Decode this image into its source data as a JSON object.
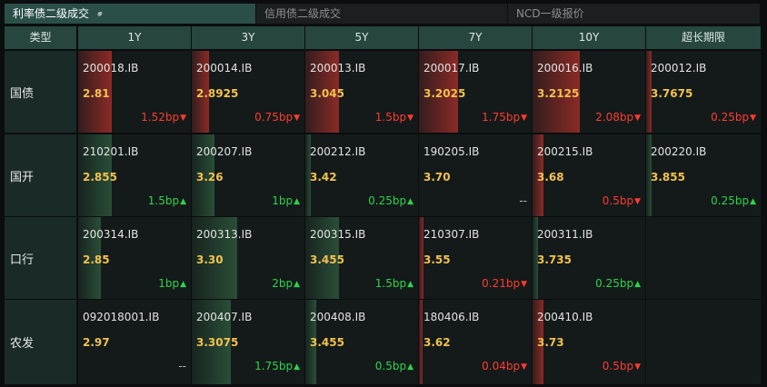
{
  "tabs": [
    {
      "label": "利率债二级成交",
      "active": true
    },
    {
      "label": "信用债二级成交",
      "active": false
    },
    {
      "label": "NCD一级报价",
      "active": false
    }
  ],
  "header": {
    "type_label": "类型",
    "tenors": [
      "1Y",
      "3Y",
      "5Y",
      "7Y",
      "10Y",
      "超长期限"
    ]
  },
  "colors": {
    "up": "#ff3b30",
    "down": "#2ed34a",
    "yield": "#f2c14e",
    "header_bg": "#26463f",
    "active_tab": "#2a4f49"
  },
  "rows": [
    {
      "type": "国债",
      "cells": [
        {
          "code": "200018.IB",
          "yield": "2.81",
          "change": "1.52bp",
          "dir": "up",
          "bar": 0.3
        },
        {
          "code": "200014.IB",
          "yield": "2.8925",
          "change": "0.75bp",
          "dir": "up",
          "bar": 0.15
        },
        {
          "code": "200013.IB",
          "yield": "3.045",
          "change": "1.5bp",
          "dir": "up",
          "bar": 0.3
        },
        {
          "code": "200017.IB",
          "yield": "3.2025",
          "change": "1.75bp",
          "dir": "up",
          "bar": 0.35
        },
        {
          "code": "200016.IB",
          "yield": "3.2125",
          "change": "2.08bp",
          "dir": "up",
          "bar": 0.42
        },
        {
          "code": "200012.IB",
          "yield": "3.7675",
          "change": "0.25bp",
          "dir": "up",
          "bar": 0.05
        }
      ]
    },
    {
      "type": "国开",
      "cells": [
        {
          "code": "210201.IB",
          "yield": "2.855",
          "change": "1.5bp",
          "dir": "down",
          "bar": 0.3
        },
        {
          "code": "200207.IB",
          "yield": "3.26",
          "change": "1bp",
          "dir": "down",
          "bar": 0.2
        },
        {
          "code": "200212.IB",
          "yield": "3.42",
          "change": "0.25bp",
          "dir": "down",
          "bar": 0.05
        },
        {
          "code": "190205.IB",
          "yield": "3.70",
          "change": "--",
          "dir": "flat",
          "bar": 0
        },
        {
          "code": "200215.IB",
          "yield": "3.68",
          "change": "0.5bp",
          "dir": "up",
          "bar": 0.1
        },
        {
          "code": "200220.IB",
          "yield": "3.855",
          "change": "0.25bp",
          "dir": "down",
          "bar": 0.05
        }
      ]
    },
    {
      "type": "口行",
      "cells": [
        {
          "code": "200314.IB",
          "yield": "2.85",
          "change": "1bp",
          "dir": "down",
          "bar": 0.2
        },
        {
          "code": "200313.IB",
          "yield": "3.30",
          "change": "2bp",
          "dir": "down",
          "bar": 0.4
        },
        {
          "code": "200315.IB",
          "yield": "3.455",
          "change": "1.5bp",
          "dir": "down",
          "bar": 0.3
        },
        {
          "code": "210307.IB",
          "yield": "3.55",
          "change": "0.21bp",
          "dir": "up",
          "bar": 0.04
        },
        {
          "code": "200311.IB",
          "yield": "3.735",
          "change": "0.25bp",
          "dir": "down",
          "bar": 0.05
        },
        {
          "code": "",
          "yield": "",
          "change": "",
          "dir": "none",
          "bar": 0
        }
      ]
    },
    {
      "type": "农发",
      "cells": [
        {
          "code": "092018001.IB",
          "yield": "2.97",
          "change": "--",
          "dir": "flat",
          "bar": 0
        },
        {
          "code": "200407.IB",
          "yield": "3.3075",
          "change": "1.75bp",
          "dir": "down",
          "bar": 0.35
        },
        {
          "code": "200408.IB",
          "yield": "3.455",
          "change": "0.5bp",
          "dir": "down",
          "bar": 0.1
        },
        {
          "code": "180406.IB",
          "yield": "3.62",
          "change": "0.04bp",
          "dir": "up",
          "bar": 0.01
        },
        {
          "code": "200410.IB",
          "yield": "3.73",
          "change": "0.5bp",
          "dir": "up",
          "bar": 0.1
        },
        {
          "code": "",
          "yield": "",
          "change": "",
          "dir": "none",
          "bar": 0
        }
      ]
    }
  ]
}
